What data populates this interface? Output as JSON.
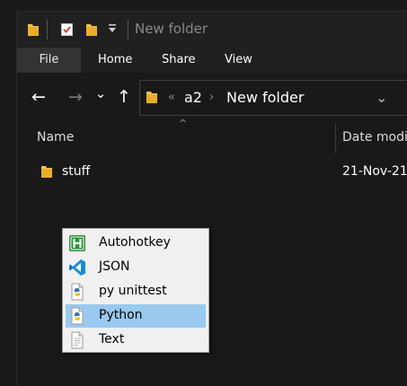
{
  "titlebar": {
    "title": "New folder",
    "icons": [
      "folder-icon",
      "properties-icon",
      "new-folder-icon",
      "customize-dropdown-icon"
    ]
  },
  "ribbon": {
    "tabs": [
      "File",
      "Home",
      "Share",
      "View"
    ]
  },
  "navigation": {
    "back": "←",
    "forward": "→",
    "recent": "⌄",
    "up": "↑"
  },
  "address": {
    "overflow": "«",
    "crumbs": [
      "a2",
      "New folder"
    ],
    "dropdown": "⌄"
  },
  "columns": {
    "name": "Name",
    "date": "Date modi"
  },
  "files": [
    {
      "name": "stuff",
      "date": "21-Nov-21",
      "icon": "folder-icon"
    }
  ],
  "popup": {
    "items": [
      {
        "label": "Autohotkey",
        "icon": "autohotkey-icon",
        "selected": false
      },
      {
        "label": "JSON",
        "icon": "vscode-icon",
        "selected": false
      },
      {
        "label": "py unittest",
        "icon": "python-file-icon",
        "selected": false
      },
      {
        "label": "Python",
        "icon": "python-file-icon",
        "selected": true
      },
      {
        "label": "Text",
        "icon": "text-file-icon",
        "selected": false
      }
    ]
  },
  "colors": {
    "background": "#191919",
    "titlebar": "#202020",
    "selected_item": "#99c9ef",
    "folder": "#f8c34a"
  }
}
